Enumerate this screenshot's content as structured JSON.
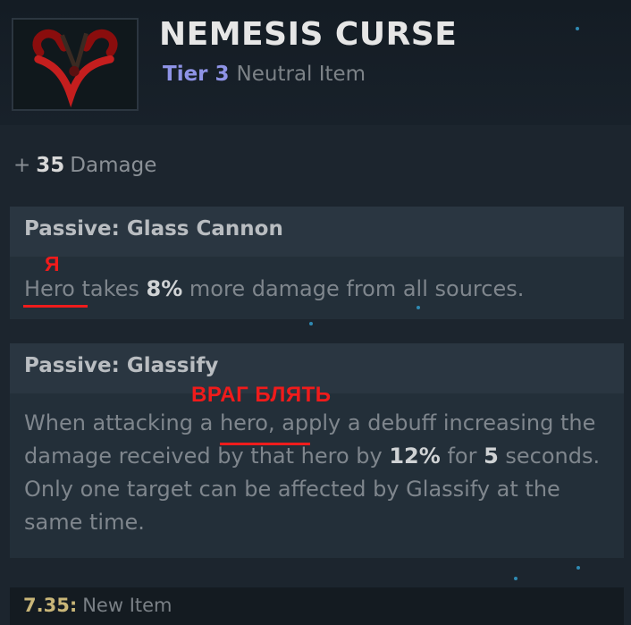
{
  "item": {
    "name": "NEMESIS CURSE",
    "tier_label": "Tier 3",
    "type_label": "Neutral Item",
    "icon": "nemesis-curse-icon"
  },
  "stat": {
    "prefix": "+",
    "value": "35",
    "label": "Damage"
  },
  "abilities": [
    {
      "title": "Passive: Glass Cannon",
      "text_1": "Hero takes ",
      "value_1": "8%",
      "text_2": " more damage from all sources."
    },
    {
      "title": "Passive: Glassify",
      "text_1": "When attacking a hero, apply a debuff increasing the damage received by that hero by ",
      "value_1": "12%",
      "text_2": " for ",
      "value_2": "5",
      "text_3": " seconds. Only one target can be affected by Glassify at the same time."
    }
  ],
  "annotations": {
    "note_1": "Я",
    "note_2": "ВРАГ БЛЯТЬ",
    "color": "#f01b1b"
  },
  "footer": {
    "version": "7.35:",
    "note": "New Item"
  },
  "colors": {
    "tier": "#8e93e6",
    "version": "#c9b678"
  }
}
